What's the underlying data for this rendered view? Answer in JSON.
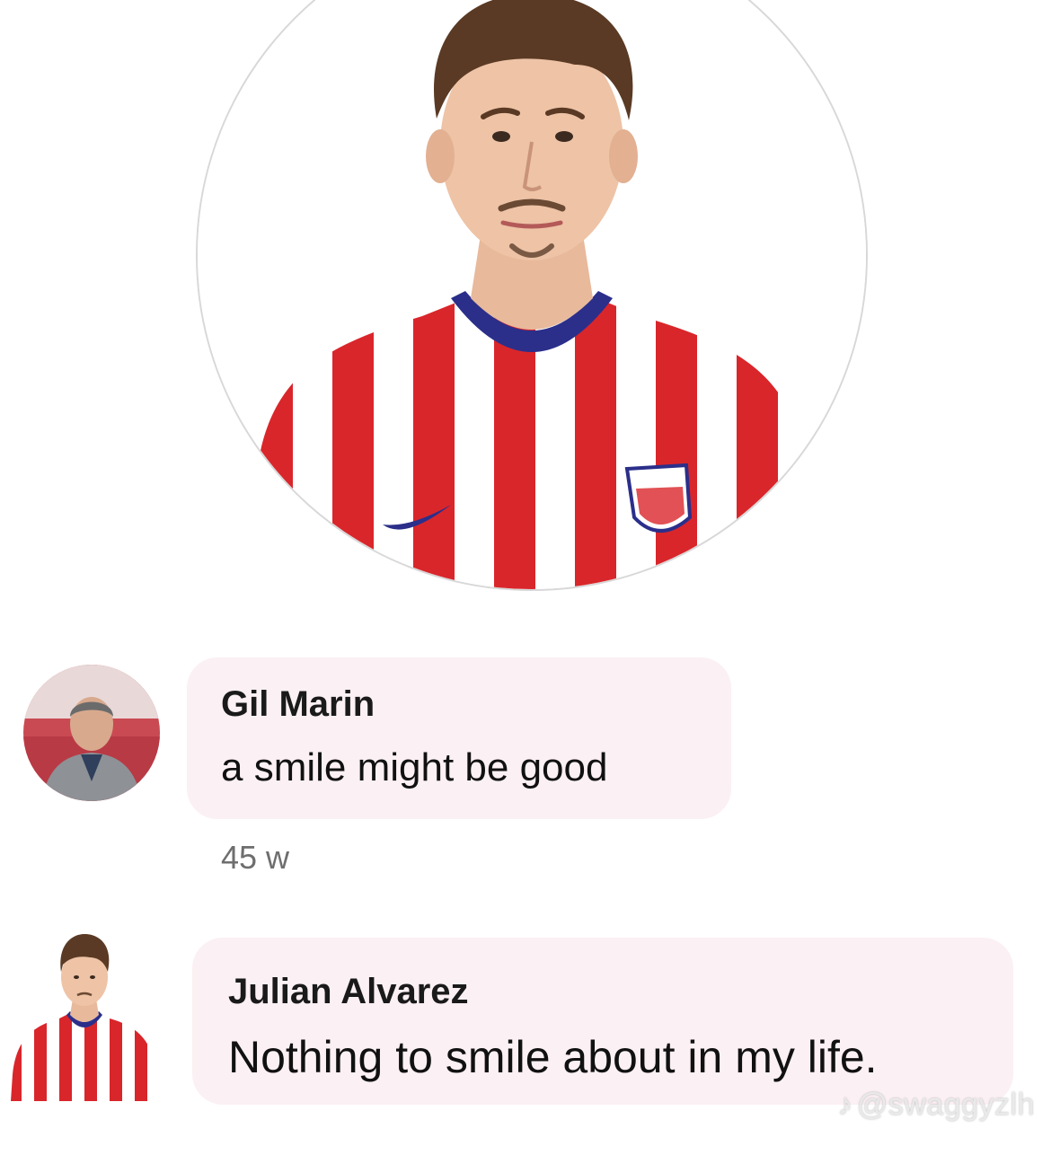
{
  "profile": {
    "avatar_icon": "player-portrait-icon"
  },
  "comments": [
    {
      "author": "Gil Marin",
      "text": "a smile might be good",
      "time": "45 w",
      "avatar_icon": "man-in-suit-avatar-icon"
    },
    {
      "author": "Julian Alvarez",
      "text": "Nothing to smile about in my life.",
      "avatar_icon": "player-portrait-icon"
    }
  ],
  "watermark": {
    "logo_icon": "tiktok-note-icon",
    "handle": "@swaggyzlh"
  },
  "colors": {
    "bubble": "#fbf0f3",
    "jersey_red": "#d9262b",
    "jersey_navy": "#2b2f8a",
    "meta_gray": "#6e6e6e"
  }
}
